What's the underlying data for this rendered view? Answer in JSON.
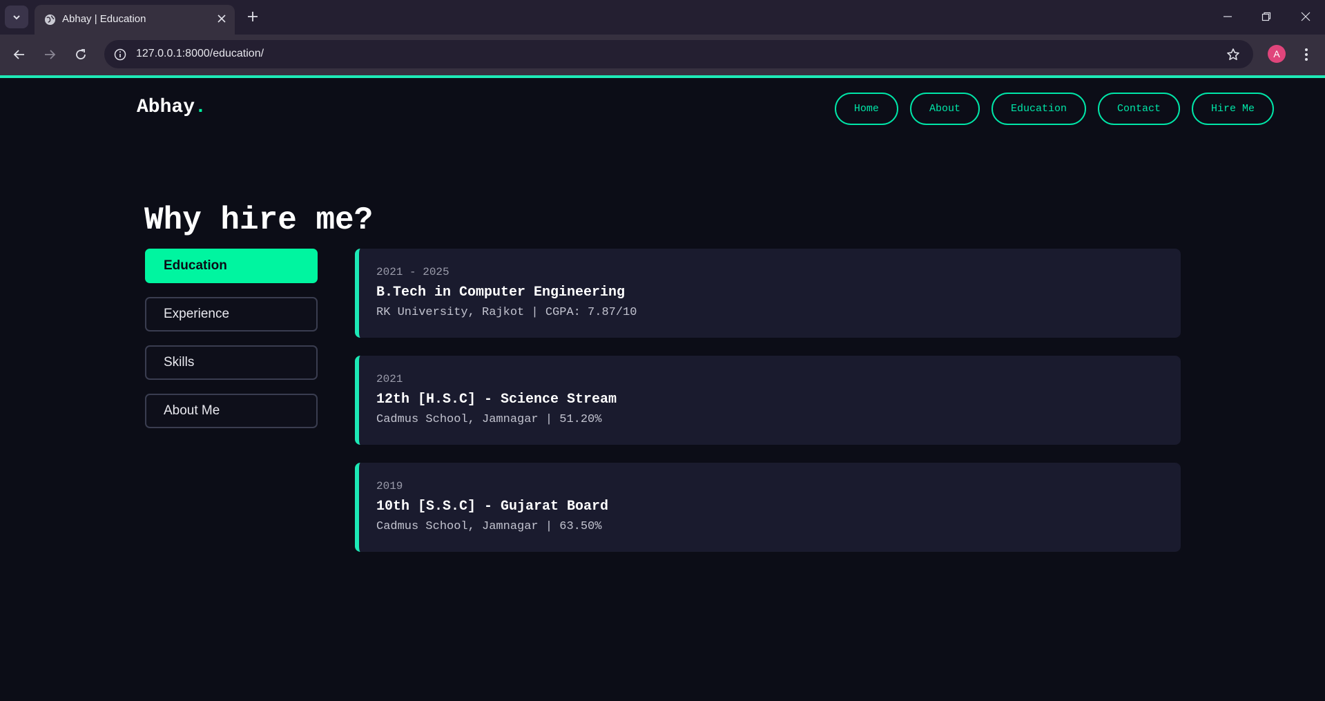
{
  "browser": {
    "tab_title": "Abhay | Education",
    "url": "127.0.0.1:8000/education/",
    "profile_initial": "A",
    "icons": {
      "tab_menu": "chevron-down-icon",
      "favicon": "globe-icon",
      "tab_close": "close-icon",
      "new_tab": "plus-icon",
      "back": "arrow-left-icon",
      "forward": "arrow-right-icon",
      "reload": "reload-icon",
      "site_info": "info-icon",
      "bookmark": "star-icon",
      "menu": "kebab-menu-icon",
      "minimize": "minimize-icon",
      "restore": "restore-icon",
      "close_window": "close-icon"
    }
  },
  "site": {
    "logo": "Abhay",
    "logo_dot": ".",
    "nav": [
      "Home",
      "About",
      "Education",
      "Contact",
      "Hire Me"
    ]
  },
  "main": {
    "heading": "Why hire me?",
    "sidebar": [
      {
        "label": "Education",
        "active": true
      },
      {
        "label": "Experience",
        "active": false
      },
      {
        "label": "Skills",
        "active": false
      },
      {
        "label": "About Me",
        "active": false
      }
    ],
    "education": [
      {
        "years": "2021 - 2025",
        "title": "B.Tech in Computer Engineering",
        "detail": "RK University, Rajkot | CGPA: 7.87/10"
      },
      {
        "years": "2021",
        "title": "12th [H.S.C] - Science Stream",
        "detail": "Cadmus School, Jamnagar | 51.20%"
      },
      {
        "years": "2019",
        "title": "10th [S.S.C] - Gujarat Board",
        "detail": "Cadmus School, Jamnagar | 63.50%"
      }
    ]
  },
  "colors": {
    "accent": "#00f5a0",
    "page_bg": "#0c0d17",
    "card_bg": "#1a1b2e"
  }
}
